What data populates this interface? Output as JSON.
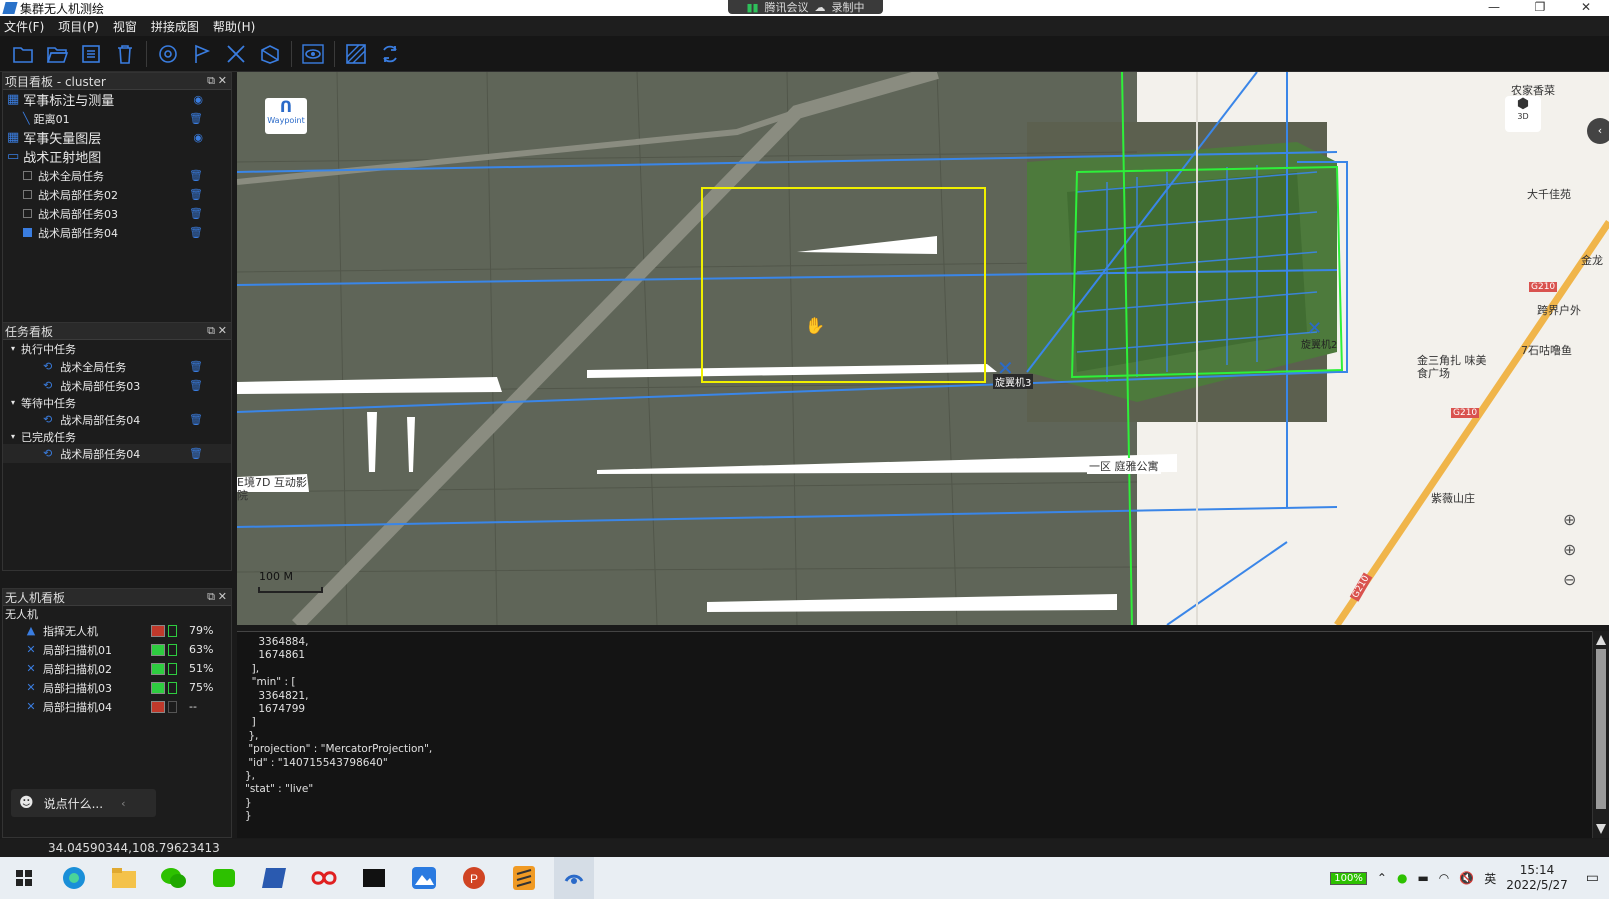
{
  "window": {
    "title": "集群无人机测绘",
    "meeting_status": "腾讯会议",
    "recording": "录制中"
  },
  "menu": [
    "文件(F)",
    "项目(P)",
    "视窗",
    "拼接成图",
    "帮助(H)"
  ],
  "project_panel": {
    "title": "项目看板 - cluster",
    "items": [
      {
        "label": "军事标注与测量",
        "level": 0,
        "action": "eye"
      },
      {
        "label": "距离01",
        "level": 1,
        "action": "trash"
      },
      {
        "label": "军事矢量图层",
        "level": 0,
        "action": "eye"
      },
      {
        "label": "战术正射地图",
        "level": 0,
        "action": ""
      },
      {
        "label": "战术全局任务",
        "level": 1,
        "checked": false,
        "action": "trash"
      },
      {
        "label": "战术局部任务02",
        "level": 1,
        "checked": false,
        "action": "trash"
      },
      {
        "label": "战术局部任务03",
        "level": 1,
        "checked": false,
        "action": "trash"
      },
      {
        "label": "战术局部任务04",
        "level": 1,
        "checked": true,
        "action": "trash"
      }
    ]
  },
  "task_panel": {
    "title": "任务看板",
    "groups": [
      {
        "label": "执行中任务",
        "items": [
          "战术全局任务",
          "战术局部任务03"
        ]
      },
      {
        "label": "等待中任务",
        "items": [
          "战术局部任务04"
        ]
      },
      {
        "label": "已完成任务",
        "items": [
          "战术局部任务04"
        ]
      }
    ]
  },
  "drone_panel": {
    "title": "无人机看板",
    "header": "无人机",
    "drones": [
      {
        "name": "指挥无人机",
        "battery": "79%",
        "status_color": "#c0392b",
        "batt_color": "#2ecc40"
      },
      {
        "name": "局部扫描机01",
        "battery": "63%",
        "status_color": "#2ecc40",
        "batt_color": "#2ecc40"
      },
      {
        "name": "局部扫描机02",
        "battery": "51%",
        "status_color": "#2ecc40",
        "batt_color": "#2ecc40"
      },
      {
        "name": "局部扫描机03",
        "battery": "75%",
        "status_color": "#2ecc40",
        "batt_color": "#2ecc40"
      },
      {
        "name": "局部扫描机04",
        "battery": "--",
        "status_color": "#c0392b",
        "batt_color": "#444"
      }
    ],
    "chat_placeholder": "说点什么..."
  },
  "map": {
    "waypoint_label": "Waypoint",
    "btn_3d": "3D",
    "scale": "100 M",
    "labels": {
      "drone3": "旋翼机3",
      "drone2": "旋翼机2",
      "poi1": "农家香菜",
      "poi2": "大千佳苑",
      "poi3": "金龙",
      "poi4": "跨界户外",
      "poi5": "7石咕噜鱼",
      "poi6": "金三角扎 味美食广场",
      "poi7": "紫薇山庄",
      "poi8": "一区 庭雅公寓",
      "poi9": "G210",
      "poi10": "G210",
      "poi11": "G210",
      "poi12": "E境7D 互动影院"
    }
  },
  "console_text": "    3364884,\n    1674861\n  ],\n  \"min\" : [\n    3364821,\n    1674799\n  ]\n },\n \"projection\" : \"MercatorProjection\",\n \"id\" : \"140715543798640\"\n},\n\"stat\" : \"live\"\n}\n}",
  "status": {
    "coords": "34.04590344,108.79623413"
  },
  "taskbar": {
    "battery": "100%",
    "ime": "英",
    "time": "15:14",
    "date": "2022/5/27"
  }
}
